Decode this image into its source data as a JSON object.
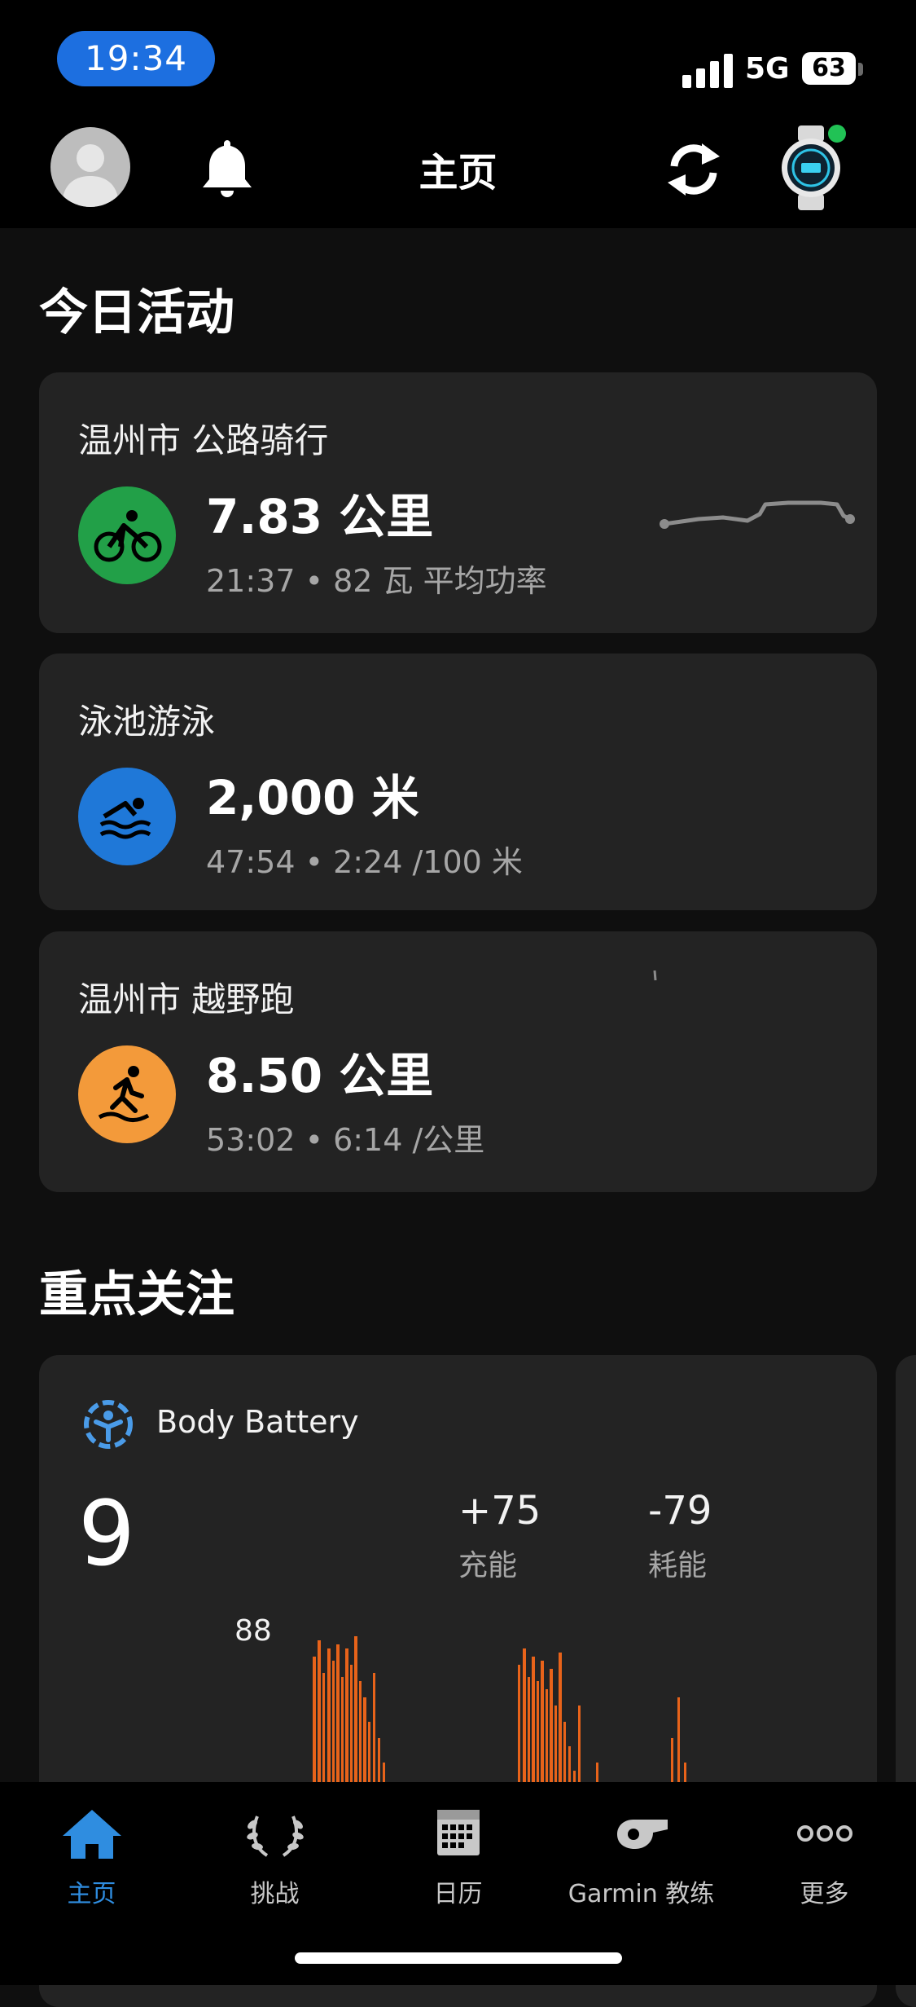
{
  "status_bar": {
    "time": "19:34",
    "network": "5G",
    "battery": "63"
  },
  "header": {
    "title": "主页"
  },
  "today": {
    "section_title": "今日活动",
    "activities": [
      {
        "title": "温州市 公路骑行",
        "main": "7.83 公里",
        "sub": "21:37 • 82 瓦 平均功率",
        "icon": "cycling-icon",
        "color": "#22a048"
      },
      {
        "title": "泳池游泳",
        "main": "2,000 米",
        "sub": "47:54 • 2:24 /100 米",
        "icon": "swimming-icon",
        "color": "#1f78d8"
      },
      {
        "title": "温州市 越野跑",
        "main": "8.50 公里",
        "sub": "53:02 • 6:14 /公里",
        "icon": "trail-running-icon",
        "color": "#f39a3a"
      }
    ]
  },
  "focus": {
    "section_title": "重点关注",
    "body_battery": {
      "title": "Body Battery",
      "value": "9",
      "charge_value": "+75",
      "charge_label": "充能",
      "drain_value": "-79",
      "drain_label": "耗能",
      "peak_label": "88"
    }
  },
  "tabbar": {
    "items": [
      {
        "label": "主页",
        "icon": "home-icon",
        "active": true
      },
      {
        "label": "挑战",
        "icon": "laurel-icon",
        "active": false
      },
      {
        "label": "日历",
        "icon": "calendar-icon",
        "active": false
      },
      {
        "label": "Garmin 教练",
        "icon": "whistle-icon",
        "active": false
      },
      {
        "label": "更多",
        "icon": "more-icon",
        "active": false
      }
    ]
  },
  "colors": {
    "accent": "#2f8de0",
    "stress": "#e8631a",
    "card": "#232323"
  }
}
